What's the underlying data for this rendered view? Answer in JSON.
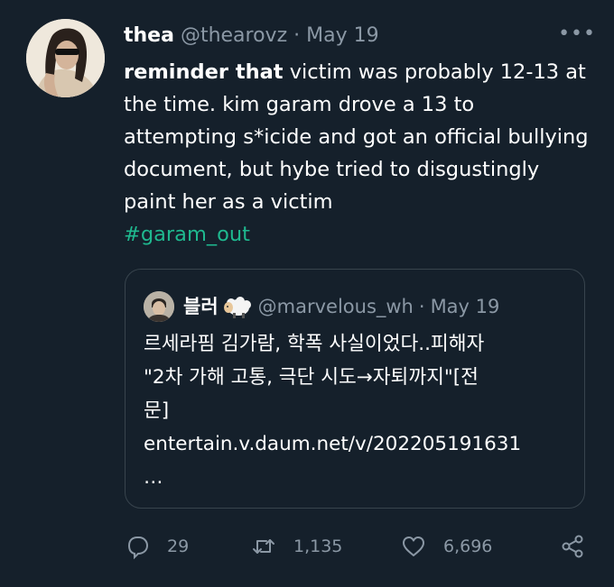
{
  "tweet": {
    "author_name": "thea",
    "author_handle": "@thearovz",
    "separator": "·",
    "date": "May 19",
    "more_label": "•••",
    "text_bold": "reminder that",
    "text_rest": " victim was probably 12-13 at the time. kim garam drove a 13 to attempting s*icide and got an official bullying document, but hybe tried to disgustingly paint her as a victim",
    "hashtag": "#garam_out"
  },
  "quote": {
    "author_name": "블러",
    "author_handle": "@marvelous_wh",
    "separator": "·",
    "date": "May 19",
    "lines": [
      "르세라핌 김가람, 학폭 사실이었다..피해자",
      "\"2차 가해 고통, 극단 시도→자퇴까지\"[전",
      "문]",
      "entertain.v.daum.net/v/202205191631",
      "…"
    ]
  },
  "actions": {
    "replies": "29",
    "retweets": "1,135",
    "likes": "6,696"
  },
  "icons": {
    "reply": "reply-icon",
    "retweet": "retweet-icon",
    "like": "heart-icon",
    "share": "share-icon",
    "more": "more-icon"
  },
  "colors": {
    "background": "#15202b",
    "text": "#ffffff",
    "muted": "#8b98a5",
    "hashtag": "#1fb98f",
    "border": "#38444d"
  }
}
